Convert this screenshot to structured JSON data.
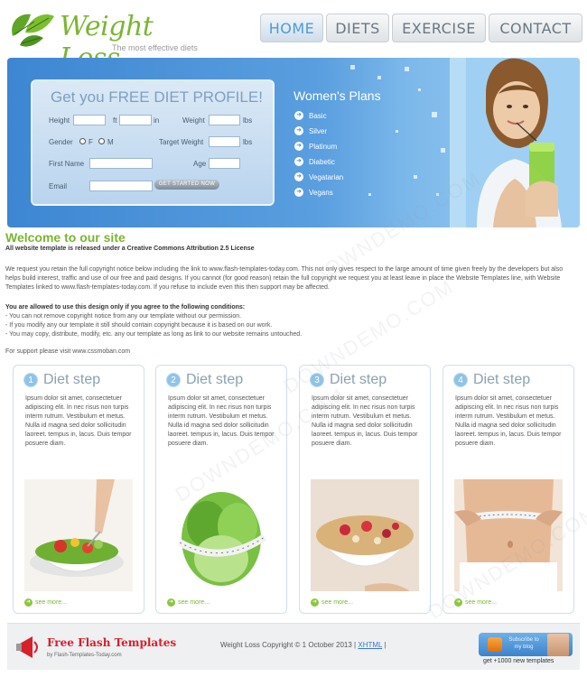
{
  "header": {
    "logo_title": "Weight Loss",
    "logo_tagline": "The most effective diets"
  },
  "nav": {
    "items": [
      {
        "label": "HOME",
        "active": true
      },
      {
        "label": "DIETS",
        "active": false
      },
      {
        "label": "EXERCISE",
        "active": false
      },
      {
        "label": "CONTACT",
        "active": false
      }
    ]
  },
  "profile_form": {
    "title": "Get you FREE DIET PROFILE!",
    "height_label": "Height",
    "ft_label": "ft",
    "in_label": "in",
    "weight_label": "Weight",
    "lbs_label": "lbs",
    "gender_label": "Gender",
    "female_label": "F",
    "male_label": "M",
    "target_weight_label": "Target Weight",
    "target_lbs_label": "lbs",
    "first_name_label": "First Name",
    "age_label": "Age",
    "email_label": "Email",
    "submit_label": "GET STARTED NOW"
  },
  "plans": {
    "title": "Women's Plans",
    "items": [
      "Basic",
      "Silver",
      "Platinum",
      "Diabetic",
      "Vegatarian",
      "Vegans"
    ]
  },
  "intro": {
    "heading": "Welcome to our site",
    "license": "All website template is released under a Creative Commons Attribution 2.5 License",
    "paragraph1": "We request you retain the full copyright notice below including the link to www.flash-templates-today.com. This not only gives respect to the large amount of time given freely by the developers but also helps build interest, traffic and use of our free and paid designs. If you cannot (for good reason) retain the full copyright we request you at least leave in place the Website Templates line, with Website Templates linked to www.flash-templates-today.com. If you refuse to include even this then support may be affected.",
    "conditions_title": "You are allowed to use this design only if you agree to the following conditions:",
    "conditions": [
      "- You can not remove copyright notice from any our template without our permission.",
      "- If you modify any our template it still should contain copyright because it is based on our work.",
      "- You may copy, distribute, modify, etc. any our template as long as link to our website remains untouched."
    ],
    "support": "For support please visit www.cssmoban.com"
  },
  "steps": [
    {
      "number": "1",
      "title": "Diet step",
      "text": "Ipsum dolor sit amet, consectetuer adipiscing elit. In nec risus non turpis interm rutrum. Vestibulum et metus. Nulla id magna sed dolor sollicitudin laoreet. tempus in, lacus. Duis tempor posuere diam.",
      "more": "see more..."
    },
    {
      "number": "2",
      "title": "Diet step",
      "text": "Ipsum dolor sit amet, consectetuer adipiscing elit. In nec risus non turpis interm rutrum. Vestibulum et metus. Nulla id magna sed dolor sollicitudin laoreet. tempus in, lacus. Duis tempor posuere diam.",
      "more": "see more..."
    },
    {
      "number": "3",
      "title": "Diet step",
      "text": "Ipsum dolor sit amet, consectetuer adipiscing elit. In nec risus non turpis interm rutrum. Vestibulum et metus. Nulla id magna sed dolor sollicitudin laoreet. tempus in, lacus. Duis tempor posuere diam.",
      "more": "see more..."
    },
    {
      "number": "4",
      "title": "Diet step",
      "text": "Ipsum dolor sit amet, consectetuer adipiscing elit. In nec risus non turpis interm rutrum. Vestibulum et metus. Nulla id magna sed dolor sollicitudin laoreet. tempus in, lacus. Duis tempor posuere diam.",
      "more": "see more..."
    }
  ],
  "footer": {
    "brand_title": "Free Flash Templates",
    "brand_subtitle": "by Flash-Templates-Today.com",
    "copyright": "Weight Loss Copyright © 1 October 2013 | ",
    "xhtml_link": "XHTML",
    "copyright_end": " |",
    "subscribe_text": "Subscribe to my blog",
    "new_templates": "get +1000 new templates"
  },
  "colors": {
    "brand_green": "#7ab632",
    "nav_active": "#4e9cd6",
    "banner_blue": "#3d86d2",
    "footer_red": "#d8202a"
  },
  "icons": {
    "logo": "mint-leaf-icon",
    "plan_bullet": "arrow-circle-icon",
    "more_bullet": "arrow-circle-icon",
    "brand": "megaphone-icon",
    "subscribe": "rss-icon"
  },
  "watermark": "DOWNDEMO.COM"
}
